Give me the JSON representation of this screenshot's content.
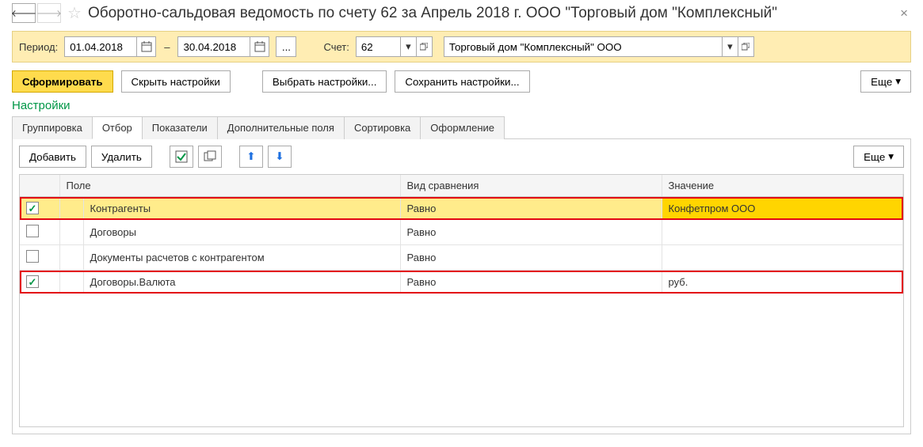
{
  "header": {
    "title": "Оборотно-сальдовая ведомость по счету 62 за Апрель 2018 г. ООО \"Торговый дом \"Комплексный\""
  },
  "period": {
    "label": "Период:",
    "from": "01.04.2018",
    "to": "30.04.2018",
    "dash": "–",
    "dots": "...",
    "account_label": "Счет:",
    "account": "62",
    "org": "Торговый дом \"Комплексный\" ООО"
  },
  "actions": {
    "form": "Сформировать",
    "hide": "Скрыть настройки",
    "choose": "Выбрать настройки...",
    "save": "Сохранить настройки...",
    "more": "Еще"
  },
  "settings_title": "Настройки",
  "tabs": {
    "group": "Группировка",
    "filter": "Отбор",
    "indicators": "Показатели",
    "extra": "Дополнительные поля",
    "sort": "Сортировка",
    "design": "Оформление"
  },
  "toolbar": {
    "add": "Добавить",
    "del": "Удалить",
    "more": "Еще"
  },
  "grid": {
    "headers": {
      "field": "Поле",
      "compare": "Вид сравнения",
      "value": "Значение"
    },
    "rows": [
      {
        "checked": true,
        "highlight": true,
        "selected": true,
        "field": "Контрагенты",
        "compare": "Равно",
        "value": "Конфетпром ООО"
      },
      {
        "checked": false,
        "highlight": false,
        "selected": false,
        "field": "Договоры",
        "compare": "Равно",
        "value": ""
      },
      {
        "checked": false,
        "highlight": false,
        "selected": false,
        "field": "Документы расчетов с контрагентом",
        "compare": "Равно",
        "value": ""
      },
      {
        "checked": true,
        "highlight": true,
        "selected": false,
        "field": "Договоры.Валюта",
        "compare": "Равно",
        "value": "руб."
      }
    ]
  }
}
